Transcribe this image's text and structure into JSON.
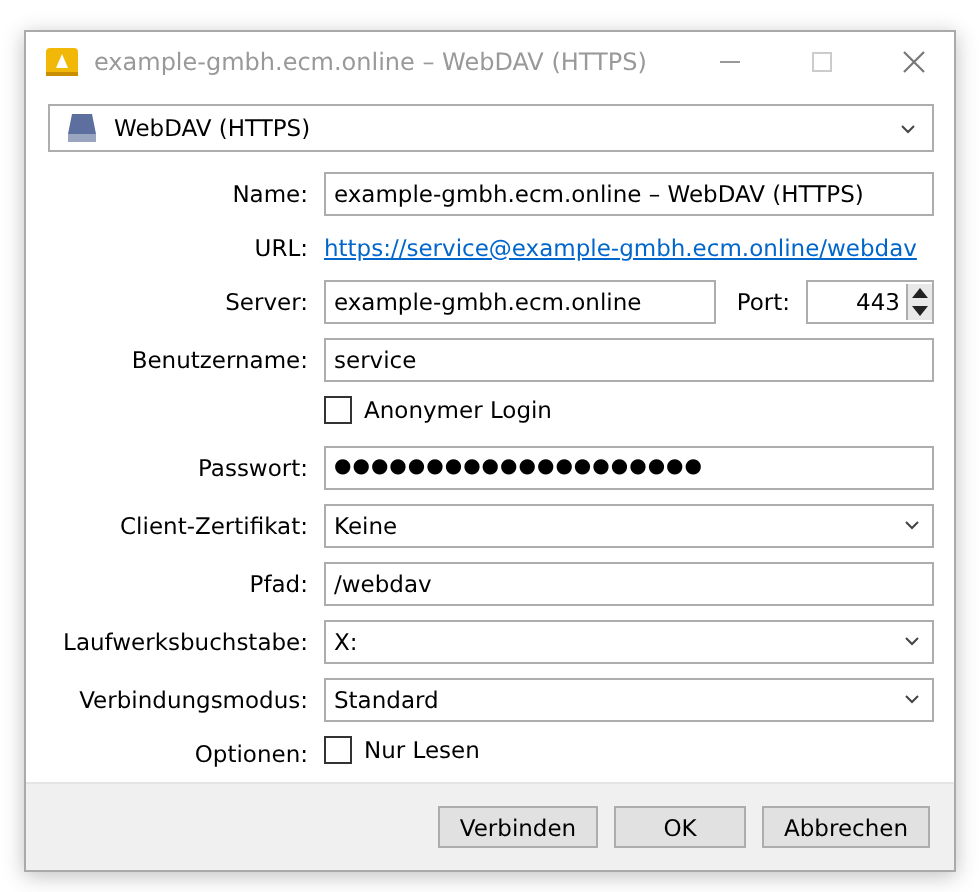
{
  "window": {
    "title": "example-gmbh.ecm.online – WebDAV (HTTPS)"
  },
  "connection_type": {
    "value": "WebDAV (HTTPS)"
  },
  "fields": [
    {
      "kind": "text",
      "label": "Name:",
      "value": "example-gmbh.ecm.online – WebDAV (HTTPS)"
    },
    {
      "kind": "link",
      "label": "URL:",
      "value": "https://service@example-gmbh.ecm.online/webdav"
    },
    {
      "kind": "server",
      "label": "Server:",
      "value": "example-gmbh.ecm.online",
      "port_label": "Port:",
      "port": "443"
    },
    {
      "kind": "text",
      "label": "Benutzername:",
      "value": "service"
    },
    {
      "kind": "checkbox",
      "text": "Anonymer Login",
      "checked": false
    },
    {
      "kind": "password",
      "label": "Passwort:",
      "value": "●●●●●●●●●●●●●●●●●●●●"
    },
    {
      "kind": "select",
      "label": "Client-Zertifikat:",
      "value": "Keine"
    },
    {
      "kind": "text",
      "label": "Pfad:",
      "value": "/webdav"
    },
    {
      "kind": "select",
      "label": "Laufwerksbuchstabe:",
      "value": "X:"
    },
    {
      "kind": "select",
      "label": "Verbindungsmodus:",
      "value": "Standard"
    },
    {
      "kind": "checkbox",
      "label": "Optionen:",
      "text": "Nur Lesen",
      "checked": false
    }
  ],
  "buttons": [
    "Verbinden",
    "OK",
    "Abbrechen"
  ]
}
